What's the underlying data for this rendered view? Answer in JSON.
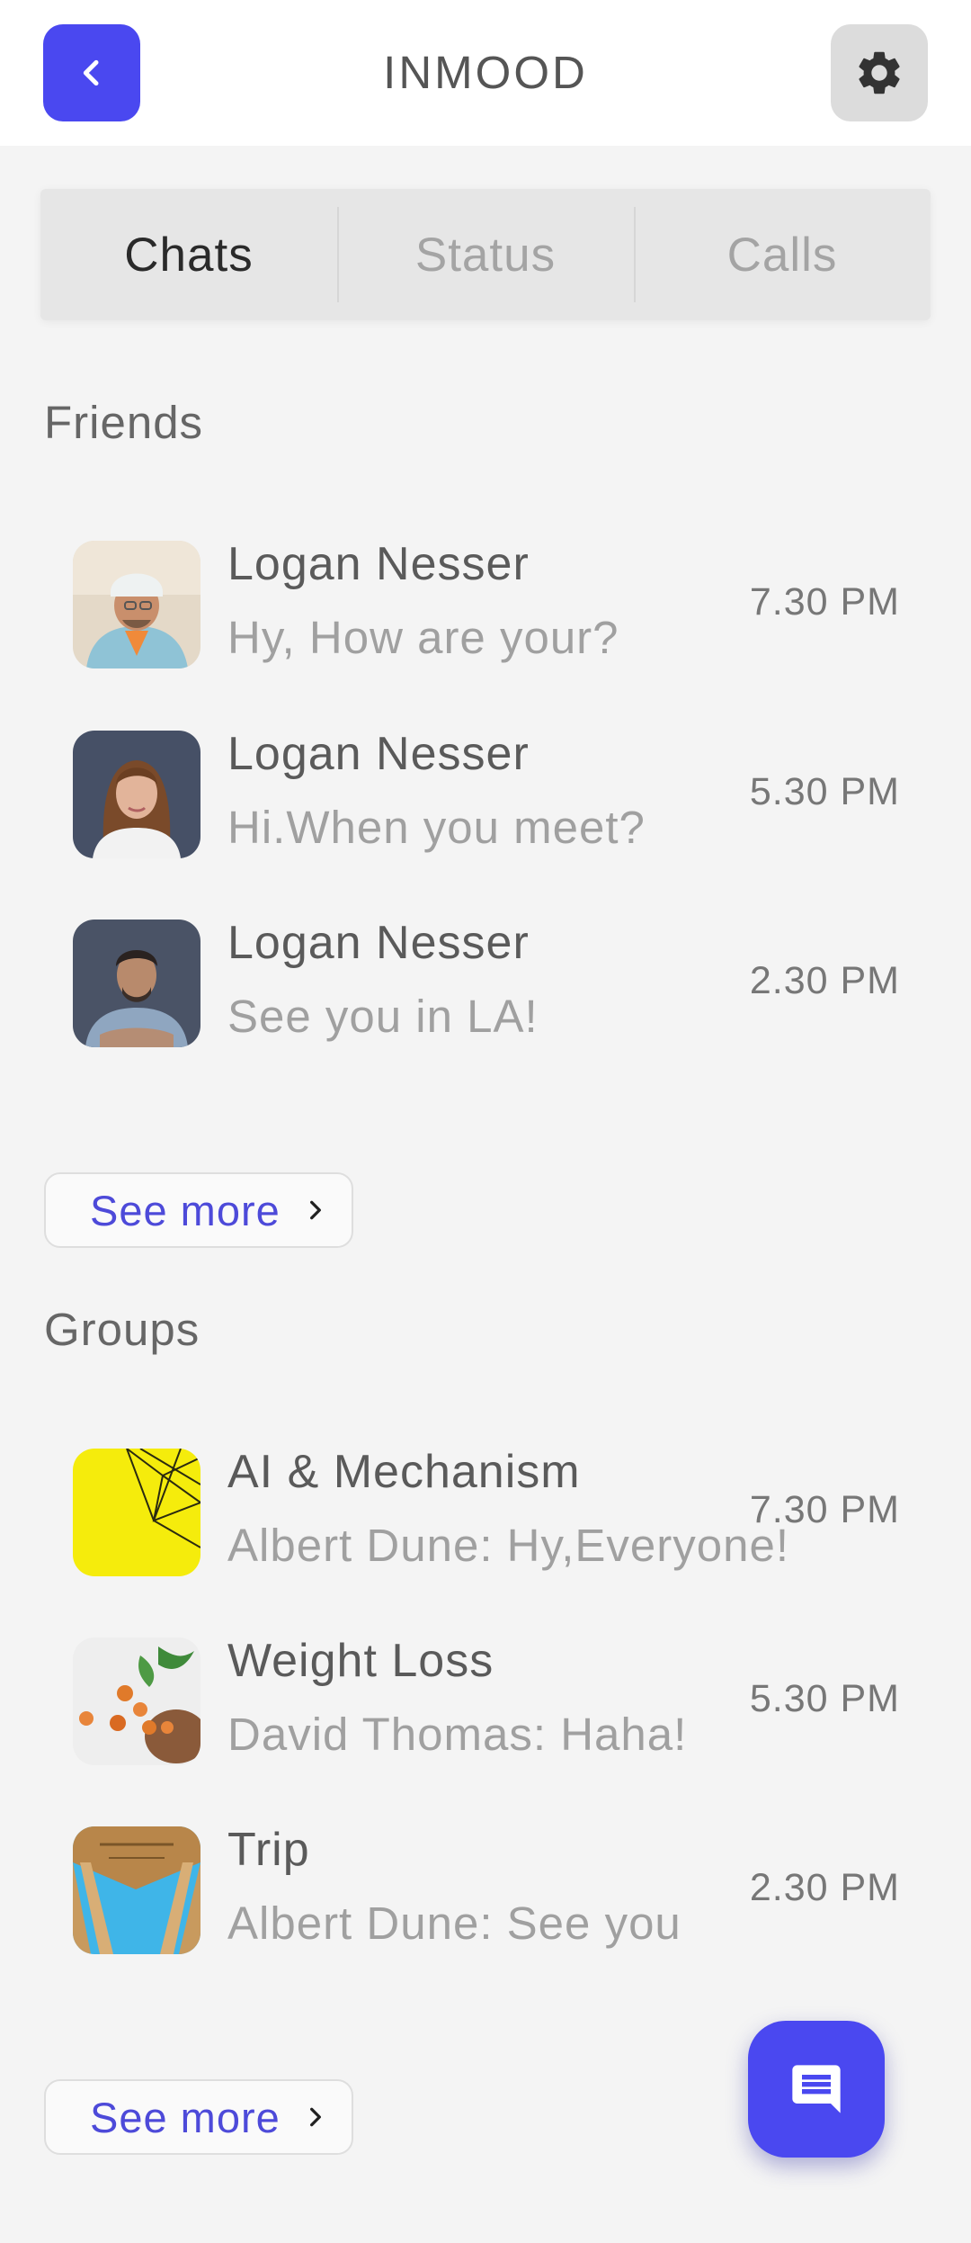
{
  "header": {
    "title": "INMOOD",
    "back_icon": "chevron-left-icon",
    "settings_icon": "gear-icon",
    "accent_color": "#4a48f0"
  },
  "tabs": [
    {
      "label": "Chats",
      "active": true
    },
    {
      "label": "Status",
      "active": false
    },
    {
      "label": "Calls",
      "active": false
    }
  ],
  "friends": {
    "title": "Friends",
    "items": [
      {
        "name": "Logan Nesser",
        "message": "Hy, How are your?",
        "time": "7.30 PM"
      },
      {
        "name": "Logan Nesser",
        "message": "Hi.When you meet?",
        "time": "5.30 PM"
      },
      {
        "name": "Logan Nesser",
        "message": "See you in LA!",
        "time": "2.30 PM"
      }
    ],
    "see_more": "See more"
  },
  "groups": {
    "title": "Groups",
    "items": [
      {
        "name": "AI & Mechanism",
        "message": "Albert Dune: Hy,Everyone!",
        "time": "7.30 PM"
      },
      {
        "name": "Weight Loss",
        "message": "David Thomas: Haha!",
        "time": "5.30 PM"
      },
      {
        "name": "Trip",
        "message": "Albert Dune: See you",
        "time": "2.30 PM"
      }
    ],
    "see_more": "See more"
  },
  "fab": {
    "icon": "chat-bubble-icon"
  }
}
